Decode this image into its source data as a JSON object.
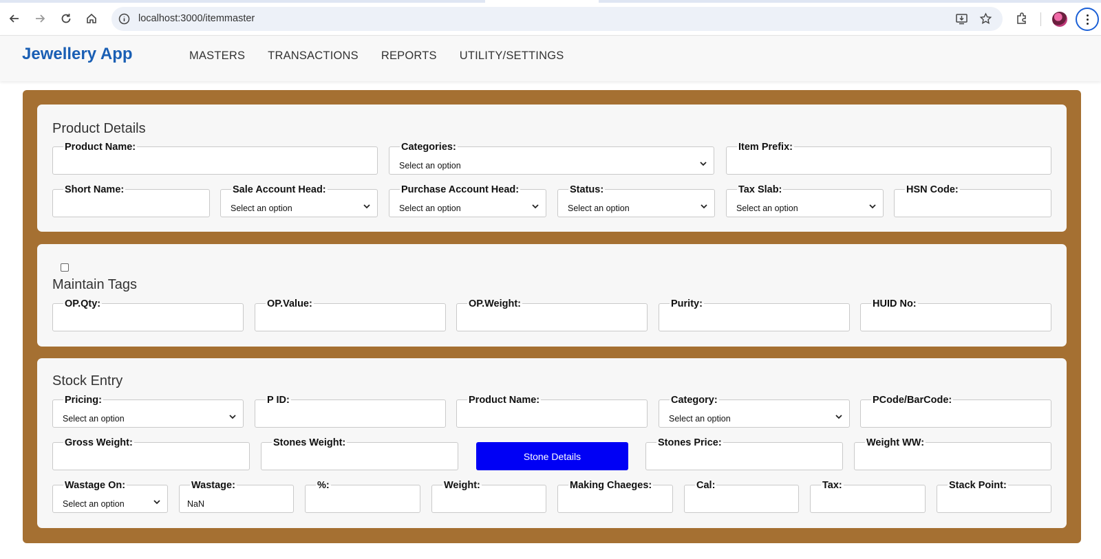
{
  "browser": {
    "url": "localhost:3000/itemmaster"
  },
  "app": {
    "brand": "Jewellery App",
    "nav": [
      "MASTERS",
      "TRANSACTIONS",
      "REPORTS",
      "UTILITY/SETTINGS"
    ]
  },
  "product_details": {
    "title": "Product Details",
    "product_name_label": "Product Name:",
    "categories_label": "Categories:",
    "categories_value": "Select an option",
    "item_prefix_label": "Item Prefix:",
    "short_name_label": "Short Name:",
    "sale_account_head_label": "Sale Account Head:",
    "sale_account_head_value": "Select an option",
    "purchase_account_head_label": "Purchase Account Head:",
    "purchase_account_head_value": "Select an option",
    "status_label": "Status:",
    "status_value": "Select an option",
    "tax_slab_label": "Tax Slab:",
    "tax_slab_value": "Select an option",
    "hsn_code_label": "HSN Code:"
  },
  "maintain_tags": {
    "title": "Maintain Tags",
    "op_qty_label": "OP.Qty:",
    "op_value_label": "OP.Value:",
    "op_weight_label": "OP.Weight:",
    "purity_label": "Purity:",
    "huid_no_label": "HUID No:"
  },
  "stock_entry": {
    "title": "Stock Entry",
    "pricing_label": "Pricing:",
    "pricing_value": "Select an option",
    "pid_label": "P ID:",
    "product_name_label": "Product Name:",
    "category_label": "Category:",
    "category_value": "Select an option",
    "pcode_label": "PCode/BarCode:",
    "gross_weight_label": "Gross Weight:",
    "stones_weight_label": "Stones Weight:",
    "stone_details_button": "Stone Details",
    "stones_price_label": "Stones Price:",
    "weight_ww_label": "Weight WW:",
    "wastage_on_label": "Wastage On:",
    "wastage_on_value": "Select an option",
    "wastage_label": "Wastage:",
    "wastage_value": "NaN",
    "percent_label": "%:",
    "weight_label": "Weight:",
    "making_charges_label": "Making Chaeges:",
    "cal_label": "Cal:",
    "tax_label": "Tax:",
    "stack_point_label": "Stack Point:"
  },
  "colors": {
    "frame": "#a57032",
    "brand": "#1a5fb4",
    "button": "#0000f5"
  }
}
